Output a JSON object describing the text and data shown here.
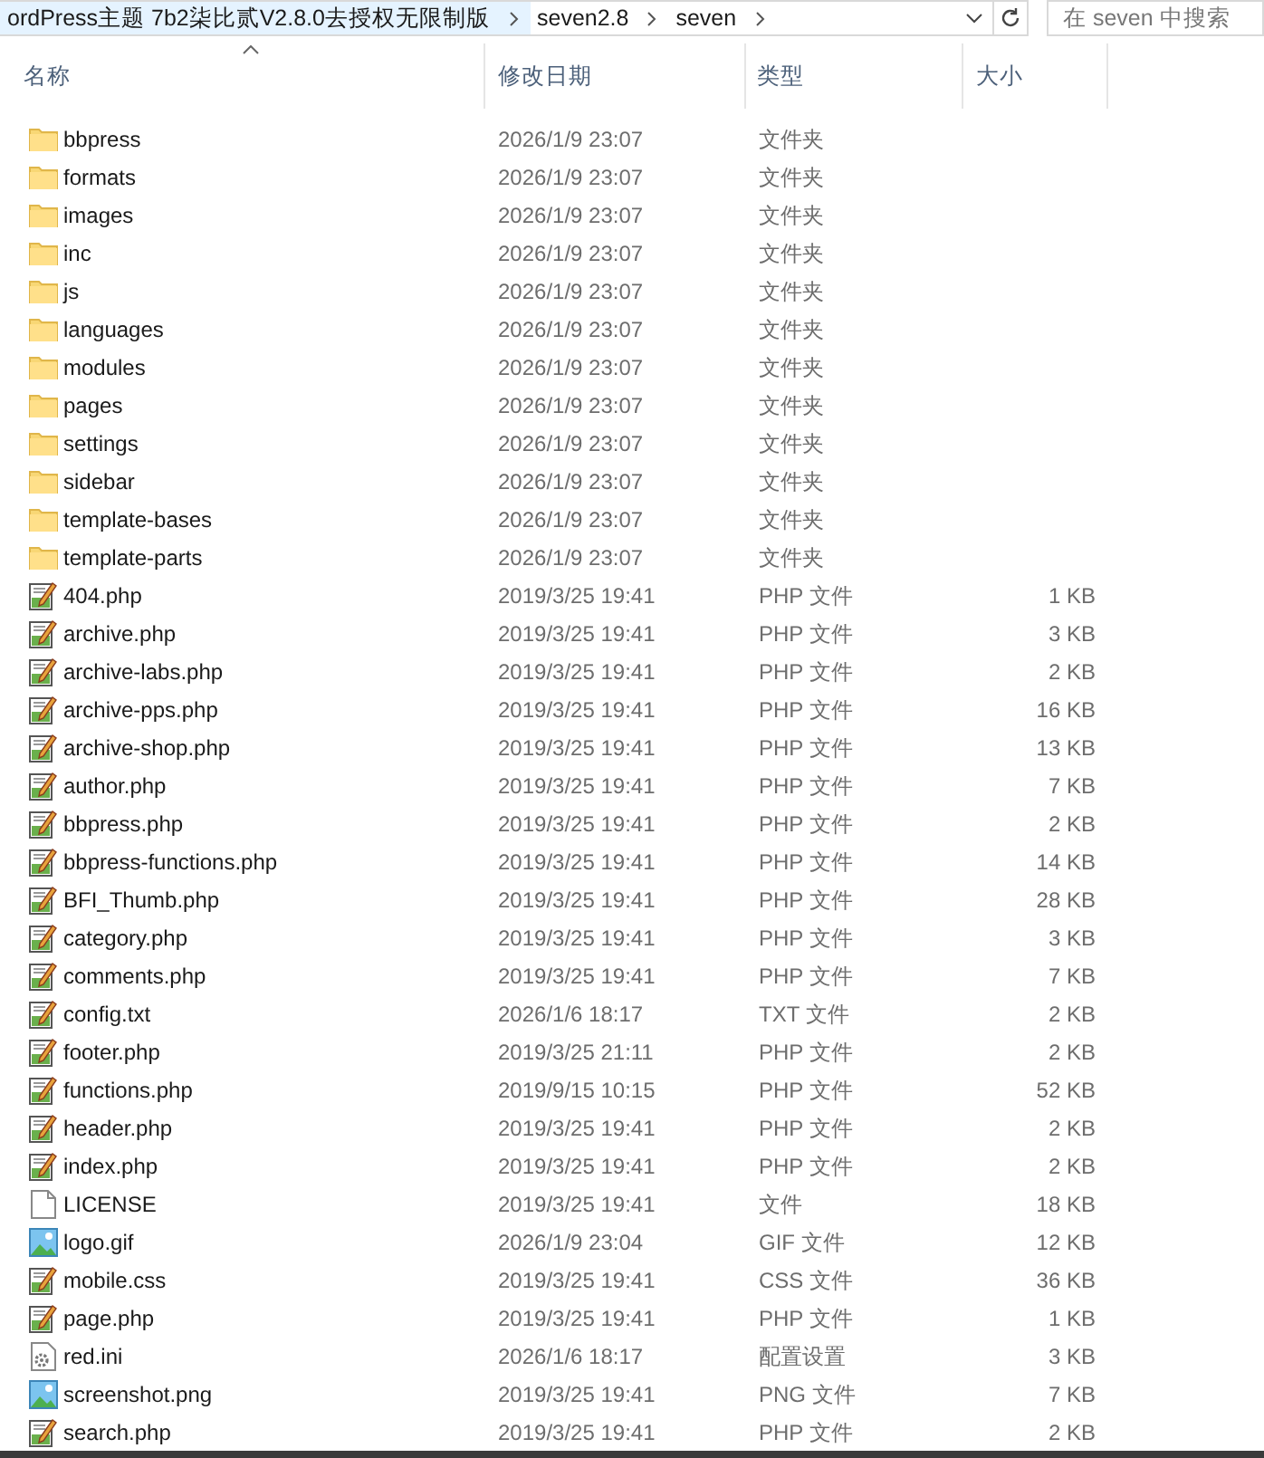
{
  "address_bar": {
    "crumbs": [
      "ordPress主题 7b2柒比贰V2.8.0去授权无限制版",
      "seven2.8",
      "seven"
    ]
  },
  "search": {
    "placeholder": "在 seven 中搜索"
  },
  "columns": [
    "名称",
    "修改日期",
    "类型",
    "大小"
  ],
  "files": [
    {
      "kind": "folder",
      "name": "bbpress",
      "date": "2026/1/9 23:07",
      "type": "文件夹"
    },
    {
      "kind": "folder",
      "name": "formats",
      "date": "2026/1/9 23:07",
      "type": "文件夹"
    },
    {
      "kind": "folder",
      "name": "images",
      "date": "2026/1/9 23:07",
      "type": "文件夹"
    },
    {
      "kind": "folder",
      "name": "inc",
      "date": "2026/1/9 23:07",
      "type": "文件夹"
    },
    {
      "kind": "folder",
      "name": "js",
      "date": "2026/1/9 23:07",
      "type": "文件夹"
    },
    {
      "kind": "folder",
      "name": "languages",
      "date": "2026/1/9 23:07",
      "type": "文件夹"
    },
    {
      "kind": "folder",
      "name": "modules",
      "date": "2026/1/9 23:07",
      "type": "文件夹"
    },
    {
      "kind": "folder",
      "name": "pages",
      "date": "2026/1/9 23:07",
      "type": "文件夹"
    },
    {
      "kind": "folder",
      "name": "settings",
      "date": "2026/1/9 23:07",
      "type": "文件夹"
    },
    {
      "kind": "folder",
      "name": "sidebar",
      "date": "2026/1/9 23:07",
      "type": "文件夹"
    },
    {
      "kind": "folder",
      "name": "template-bases",
      "date": "2026/1/9 23:07",
      "type": "文件夹"
    },
    {
      "kind": "folder",
      "name": "template-parts",
      "date": "2026/1/9 23:07",
      "type": "文件夹"
    },
    {
      "kind": "script",
      "name": "404.php",
      "date": "2019/3/25 19:41",
      "type": "PHP 文件",
      "size": "1 KB"
    },
    {
      "kind": "script",
      "name": "archive.php",
      "date": "2019/3/25 19:41",
      "type": "PHP 文件",
      "size": "3 KB"
    },
    {
      "kind": "script",
      "name": "archive-labs.php",
      "date": "2019/3/25 19:41",
      "type": "PHP 文件",
      "size": "2 KB"
    },
    {
      "kind": "script",
      "name": "archive-pps.php",
      "date": "2019/3/25 19:41",
      "type": "PHP 文件",
      "size": "16 KB"
    },
    {
      "kind": "script",
      "name": "archive-shop.php",
      "date": "2019/3/25 19:41",
      "type": "PHP 文件",
      "size": "13 KB"
    },
    {
      "kind": "script",
      "name": "author.php",
      "date": "2019/3/25 19:41",
      "type": "PHP 文件",
      "size": "7 KB"
    },
    {
      "kind": "script",
      "name": "bbpress.php",
      "date": "2019/3/25 19:41",
      "type": "PHP 文件",
      "size": "2 KB"
    },
    {
      "kind": "script",
      "name": "bbpress-functions.php",
      "date": "2019/3/25 19:41",
      "type": "PHP 文件",
      "size": "14 KB"
    },
    {
      "kind": "script",
      "name": "BFI_Thumb.php",
      "date": "2019/3/25 19:41",
      "type": "PHP 文件",
      "size": "28 KB"
    },
    {
      "kind": "script",
      "name": "category.php",
      "date": "2019/3/25 19:41",
      "type": "PHP 文件",
      "size": "3 KB"
    },
    {
      "kind": "script",
      "name": "comments.php",
      "date": "2019/3/25 19:41",
      "type": "PHP 文件",
      "size": "7 KB"
    },
    {
      "kind": "script",
      "name": "config.txt",
      "date": "2026/1/6 18:17",
      "type": "TXT 文件",
      "size": "2 KB"
    },
    {
      "kind": "script",
      "name": "footer.php",
      "date": "2019/3/25 21:11",
      "type": "PHP 文件",
      "size": "2 KB"
    },
    {
      "kind": "script",
      "name": "functions.php",
      "date": "2019/9/15 10:15",
      "type": "PHP 文件",
      "size": "52 KB"
    },
    {
      "kind": "script",
      "name": "header.php",
      "date": "2019/3/25 19:41",
      "type": "PHP 文件",
      "size": "2 KB"
    },
    {
      "kind": "script",
      "name": "index.php",
      "date": "2019/3/25 19:41",
      "type": "PHP 文件",
      "size": "2 KB"
    },
    {
      "kind": "plain",
      "name": "LICENSE",
      "date": "2019/3/25 19:41",
      "type": "文件",
      "size": "18 KB"
    },
    {
      "kind": "image",
      "name": "logo.gif",
      "date": "2026/1/9 23:04",
      "type": "GIF 文件",
      "size": "12 KB"
    },
    {
      "kind": "script",
      "name": "mobile.css",
      "date": "2019/3/25 19:41",
      "type": "CSS 文件",
      "size": "36 KB"
    },
    {
      "kind": "script",
      "name": "page.php",
      "date": "2019/3/25 19:41",
      "type": "PHP 文件",
      "size": "1 KB"
    },
    {
      "kind": "config",
      "name": "red.ini",
      "date": "2026/1/6 18:17",
      "type": "配置设置",
      "size": "3 KB"
    },
    {
      "kind": "image",
      "name": "screenshot.png",
      "date": "2019/3/25 19:41",
      "type": "PNG 文件",
      "size": "7 KB"
    },
    {
      "kind": "script",
      "name": "search.php",
      "date": "2019/3/25 19:41",
      "type": "PHP 文件",
      "size": "2 KB"
    }
  ]
}
